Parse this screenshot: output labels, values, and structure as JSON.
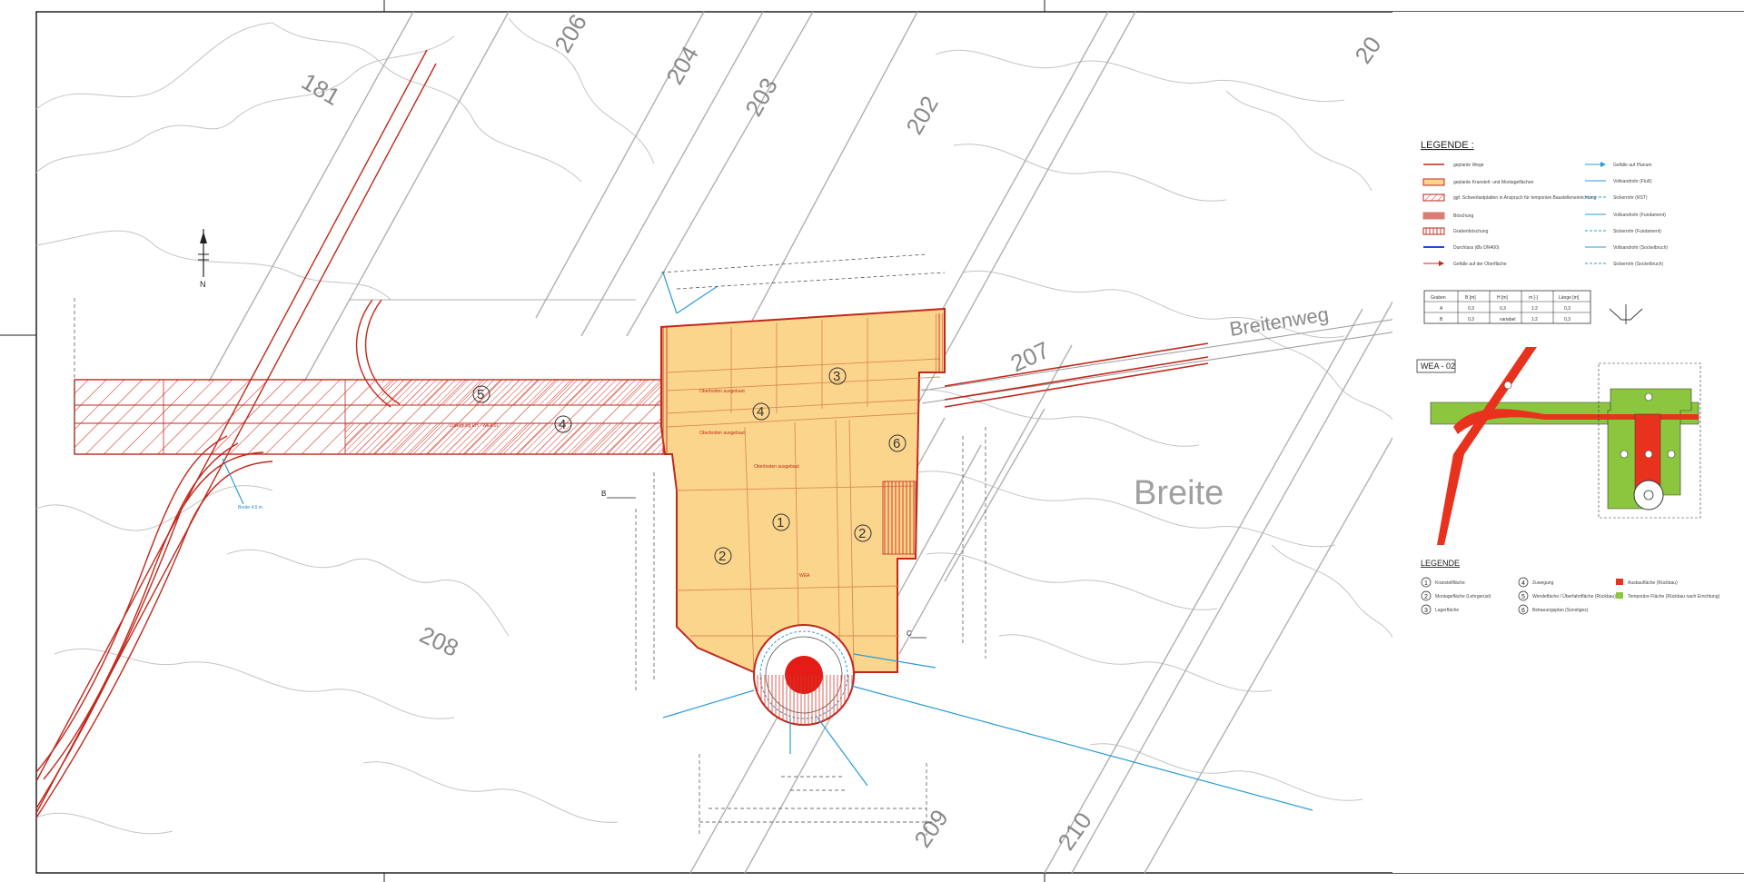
{
  "contour_labels": [
    "181",
    "206",
    "204",
    "203",
    "202",
    "208",
    "207",
    "209",
    "210",
    "20"
  ],
  "street_label": "Breitenweg",
  "area_label": "Breite",
  "north_label": "N",
  "section_label_b": "B",
  "section_label_c": "C",
  "zones": {
    "z1": "1",
    "z2a": "2",
    "z2b": "2",
    "z3": "3",
    "z4a": "4",
    "z4b": "4",
    "z5": "5",
    "z6": "6"
  },
  "annotations": {
    "oberboden_1": "Oberboden\nausgebaut",
    "oberboden_2": "Oberboden\nausgebaut",
    "oberboden_3": "Oberboden\nausgebaut",
    "wea_label": "WEA",
    "schotterweg": "Zuwegung EH - WEA 01",
    "breite_sw": "Breite 4,5 m"
  },
  "legend_main": {
    "title": "LEGENDE :",
    "left_items": [
      {
        "label": "geplante Wege",
        "swatch": "red-line"
      },
      {
        "label": "geplante Kranstell- und Montageflächen",
        "swatch": "orange-fill"
      },
      {
        "label": "ggf. Schwerlastplatten in Anspruch für temporäre Baustelleneinrichtung",
        "swatch": "red-hatch"
      },
      {
        "label": "Böschung",
        "swatch": "red-hatch-dense"
      },
      {
        "label": "Grabenböschung",
        "swatch": "red-stripes"
      },
      {
        "label": "Durchlass (Ø≥ DN400)",
        "swatch": "blue-line"
      },
      {
        "label": "Gefälle auf der Oberfläche",
        "swatch": "red-arrow"
      }
    ],
    "right_items": [
      {
        "label": "Gefälle auf Planum",
        "swatch": "blue-arrow"
      },
      {
        "label": "Vollsandrohr (Fluß)",
        "swatch": "cyan-line"
      },
      {
        "label": "Sickerrohr (RST)",
        "swatch": "cyan-dash"
      },
      {
        "label": "Vollsandrohr (Fundament)",
        "swatch": "cyan-line"
      },
      {
        "label": "Sickerrohr (Fundament)",
        "swatch": "cyan-dash"
      },
      {
        "label": "Vollsandrohr (Sockelbruch)",
        "swatch": "cyan-line"
      },
      {
        "label": "Sickerrohr (Sockelbruch)",
        "swatch": "cyan-dash"
      }
    ]
  },
  "spec_table": {
    "headers": [
      "Graben",
      "B [m]",
      "H [m]",
      "m [-]",
      "Länge [m]"
    ],
    "rows": [
      [
        "A",
        "0,3",
        "0,3",
        "1:2",
        "0,3"
      ],
      [
        "B",
        "0,3",
        "variabel",
        "1:2",
        "0,3"
      ]
    ]
  },
  "inset": {
    "title": "WEA - 02"
  },
  "legend_inset": {
    "title": "LEGENDE",
    "items": [
      {
        "num": "1",
        "label": "Kranstellfläche"
      },
      {
        "num": "2",
        "label": "Montagefläche (Lehrgerüst)"
      },
      {
        "num": "3",
        "label": "Lagerfläche"
      },
      {
        "num": "4",
        "label": "Zuwegung"
      },
      {
        "num": "5",
        "label": "Wendefläche / Überfahrtfläche (Rückbau)"
      },
      {
        "num": "6",
        "label": "Bebauungsplan (Sonstiges)"
      }
    ],
    "color_items": [
      {
        "label": "Ausbaufläche (Rückbau)",
        "color": "#e8321e"
      },
      {
        "label": "Temporäre Fläche (Rückbau nach Errichtung)",
        "color": "#8cc63f"
      }
    ]
  },
  "colors": {
    "pad_fill": "#fcd58c",
    "pad_stroke": "#d23a2a",
    "road_red": "#c2271b",
    "pipe_blue": "#2a9bd6",
    "contour_grey": "#b9b9b9",
    "tower_red": "#e41b17",
    "inset_green": "#8cc63f",
    "inset_red": "#e8321e"
  }
}
